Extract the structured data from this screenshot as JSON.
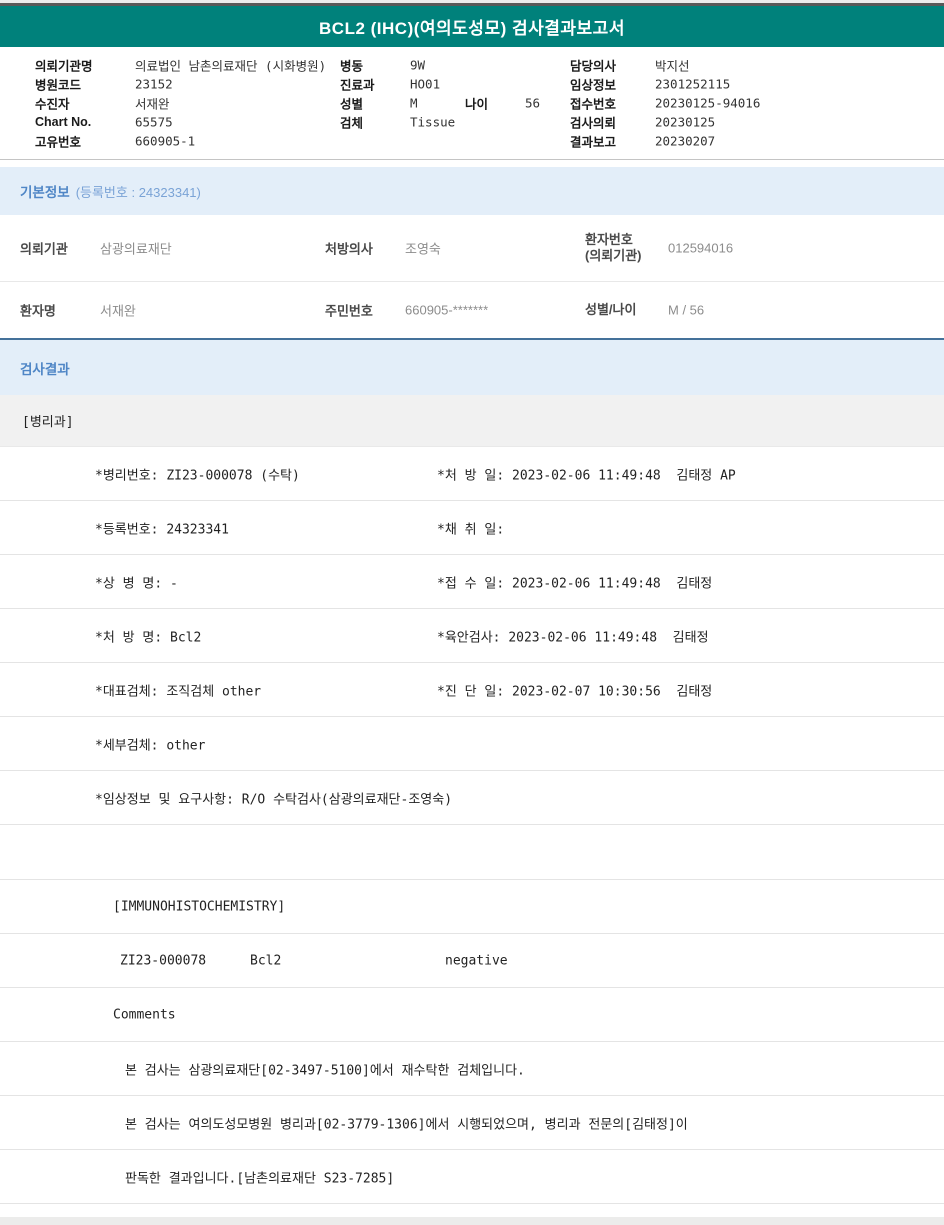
{
  "colors": {
    "teal_header": "#00817b",
    "section_bg": "#e3eef9",
    "section_title_text": "#4f86c6",
    "section_border": "#44719a"
  },
  "report": {
    "title": "BCL2 (IHC)(여의도성모) 검사결과보고서"
  },
  "header": {
    "left_fields": [
      {
        "label": "의뢰기관명",
        "value": "의료법인 남촌의료재단 (시화병원)"
      },
      {
        "label": "병원코드",
        "value": "23152"
      },
      {
        "label": "수진자",
        "value": "서재완"
      },
      {
        "label": "Chart No.",
        "value": "65575"
      },
      {
        "label": "고유번호",
        "value": "660905-1"
      }
    ],
    "middle_fields": [
      {
        "label": "병동",
        "value": "9W"
      },
      {
        "label": "진료과",
        "value": "HO01"
      },
      {
        "label": "성별",
        "value": "M",
        "label2": "나이",
        "value2": "56"
      },
      {
        "label": "검체",
        "value": "Tissue"
      }
    ],
    "right_fields": [
      {
        "label": "담당의사",
        "value": "박지선"
      },
      {
        "label": "임상정보",
        "value": "2301252115"
      },
      {
        "label": "접수번호",
        "value": "20230125-94016"
      },
      {
        "label": "검사의뢰",
        "value": "20230125"
      },
      {
        "label": "결과보고",
        "value": "20230207"
      }
    ]
  },
  "basic_info": {
    "title": "기본정보",
    "reg_no": "(등록번호 : 24323341)",
    "rows": [
      {
        "c1_label": "의뢰기관",
        "c1_value": "삼광의료재단",
        "c2_label": "처방의사",
        "c2_value": "조영숙",
        "c3_label": "환자번호",
        "c3_label2": "(의뢰기관)",
        "c3_value": "012594016"
      },
      {
        "c1_label": "환자명",
        "c1_value": "서재완",
        "c2_label": "주민번호",
        "c2_value": "660905-*******",
        "c3_label": "성별/나이",
        "c3_label2": "",
        "c3_value": "M / 56"
      }
    ]
  },
  "results": {
    "title": "검사결과",
    "department": "[병리과]",
    "rows": [
      {
        "type": "two",
        "left": "*병리번호: ZI23-000078 (수탁)",
        "right": "*처 방 일: 2023-02-06 11:49:48  김태정 AP"
      },
      {
        "type": "two",
        "left": "*등록번호: 24323341",
        "right": "*채 취 일:"
      },
      {
        "type": "two",
        "left": "*상 병 명: -",
        "right": "*접 수 일: 2023-02-06 11:49:48  김태정"
      },
      {
        "type": "two",
        "left": "*처 방 명: Bcl2",
        "right": "*육안검사: 2023-02-06 11:49:48  김태정"
      },
      {
        "type": "two",
        "left": "*대표검체: 조직검체 other",
        "right": "*진 단 일: 2023-02-07 10:30:56  김태정"
      },
      {
        "type": "two",
        "left": "*세부검체: other",
        "right": ""
      },
      {
        "type": "two",
        "left": "*임상정보 및 요구사항: R/O 수탁검사(삼광의료재단-조영숙)",
        "right": ""
      },
      {
        "type": "spacer"
      },
      {
        "type": "section",
        "text": "[IMMUNOHISTOCHEMISTRY]"
      },
      {
        "type": "result",
        "code": "ZI23-000078",
        "test": "Bcl2",
        "result": "negative"
      },
      {
        "type": "section",
        "text": "Comments"
      },
      {
        "type": "comment",
        "text": "본 검사는 삼광의료재단[02-3497-5100]에서 재수탁한 검체입니다."
      },
      {
        "type": "comment",
        "text": "본 검사는 여의도성모병원 병리과[02-3779-1306]에서 시행되었으며, 병리과 전문의[김태정]이"
      },
      {
        "type": "comment",
        "text": "판독한 결과입니다.[남촌의료재단 S23-7285]"
      }
    ]
  }
}
